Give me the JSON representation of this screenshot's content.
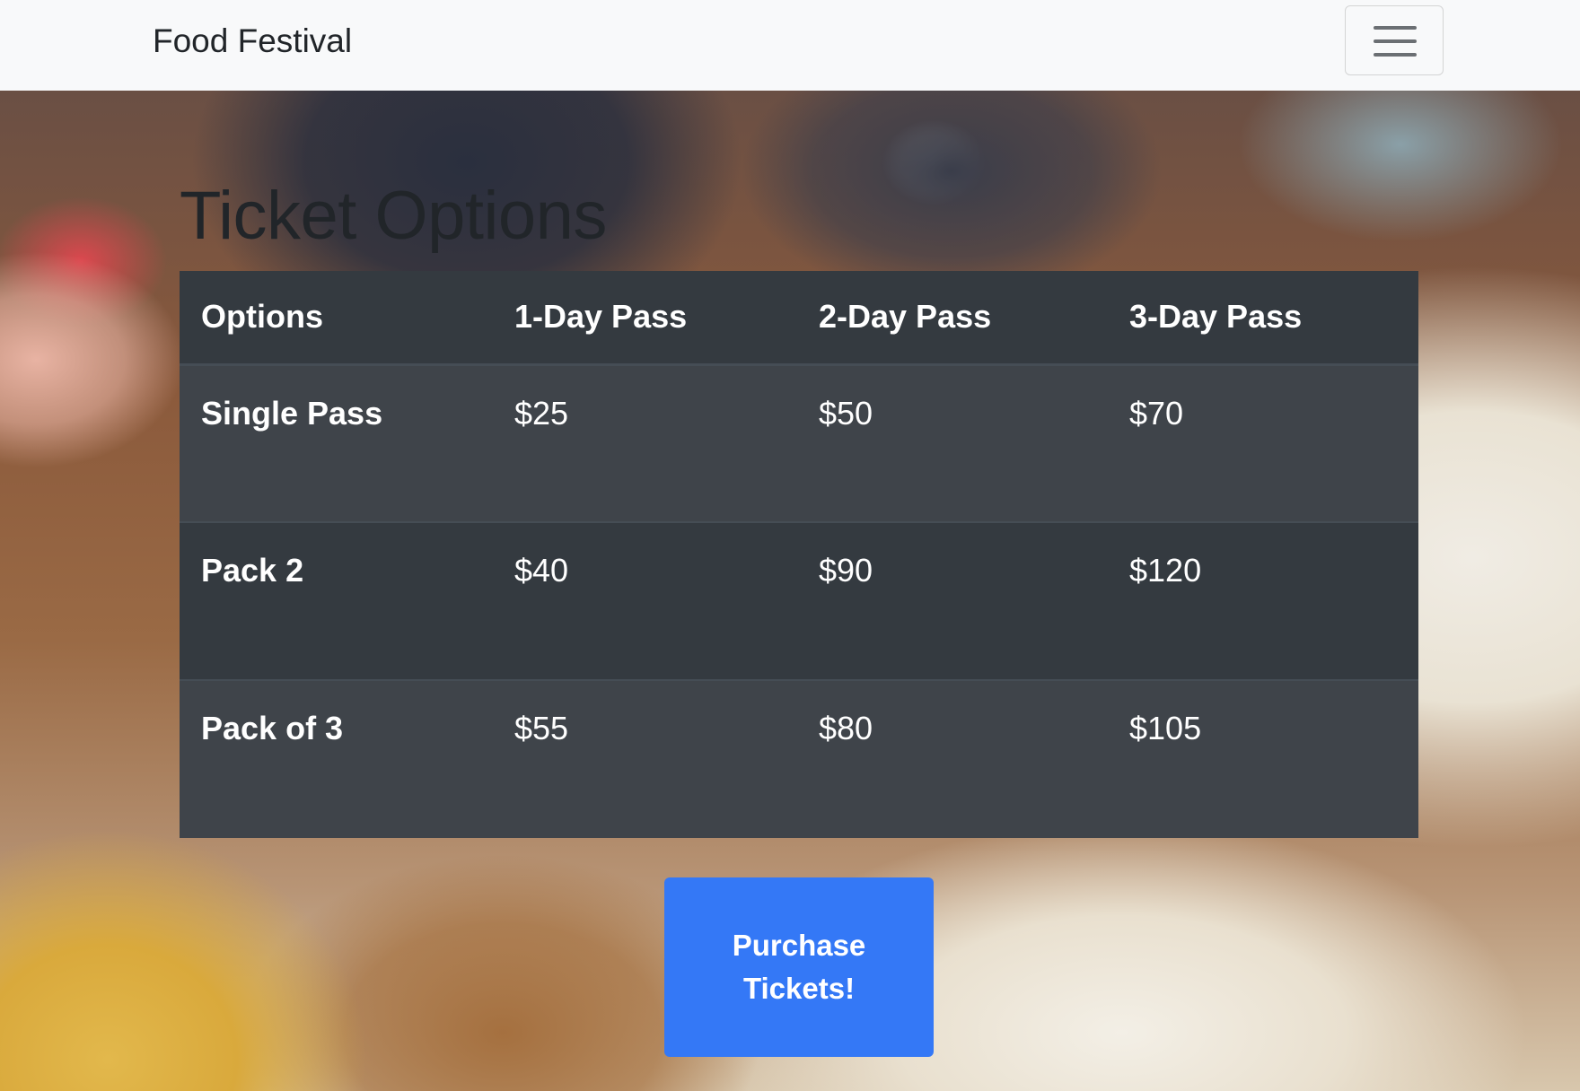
{
  "navbar": {
    "brand": "Food Festival",
    "toggle_icon": "hamburger-menu-icon"
  },
  "main": {
    "heading": "Ticket Options",
    "table": {
      "headers": [
        "Options",
        "1-Day Pass",
        "2-Day Pass",
        "3-Day Pass"
      ],
      "rows": [
        [
          "Single Pass",
          "$25",
          "$50",
          "$70"
        ],
        [
          "Pack 2",
          "$40",
          "$90",
          "$120"
        ],
        [
          "Pack of 3",
          "$55",
          "$80",
          "$105"
        ]
      ]
    },
    "purchase_button": "Purchase Tickets!"
  },
  "colors": {
    "navbar_bg": "#f8f9fa",
    "table_dark": "#343a40",
    "table_striped": "#3f444a",
    "button_primary": "#3478f6"
  }
}
